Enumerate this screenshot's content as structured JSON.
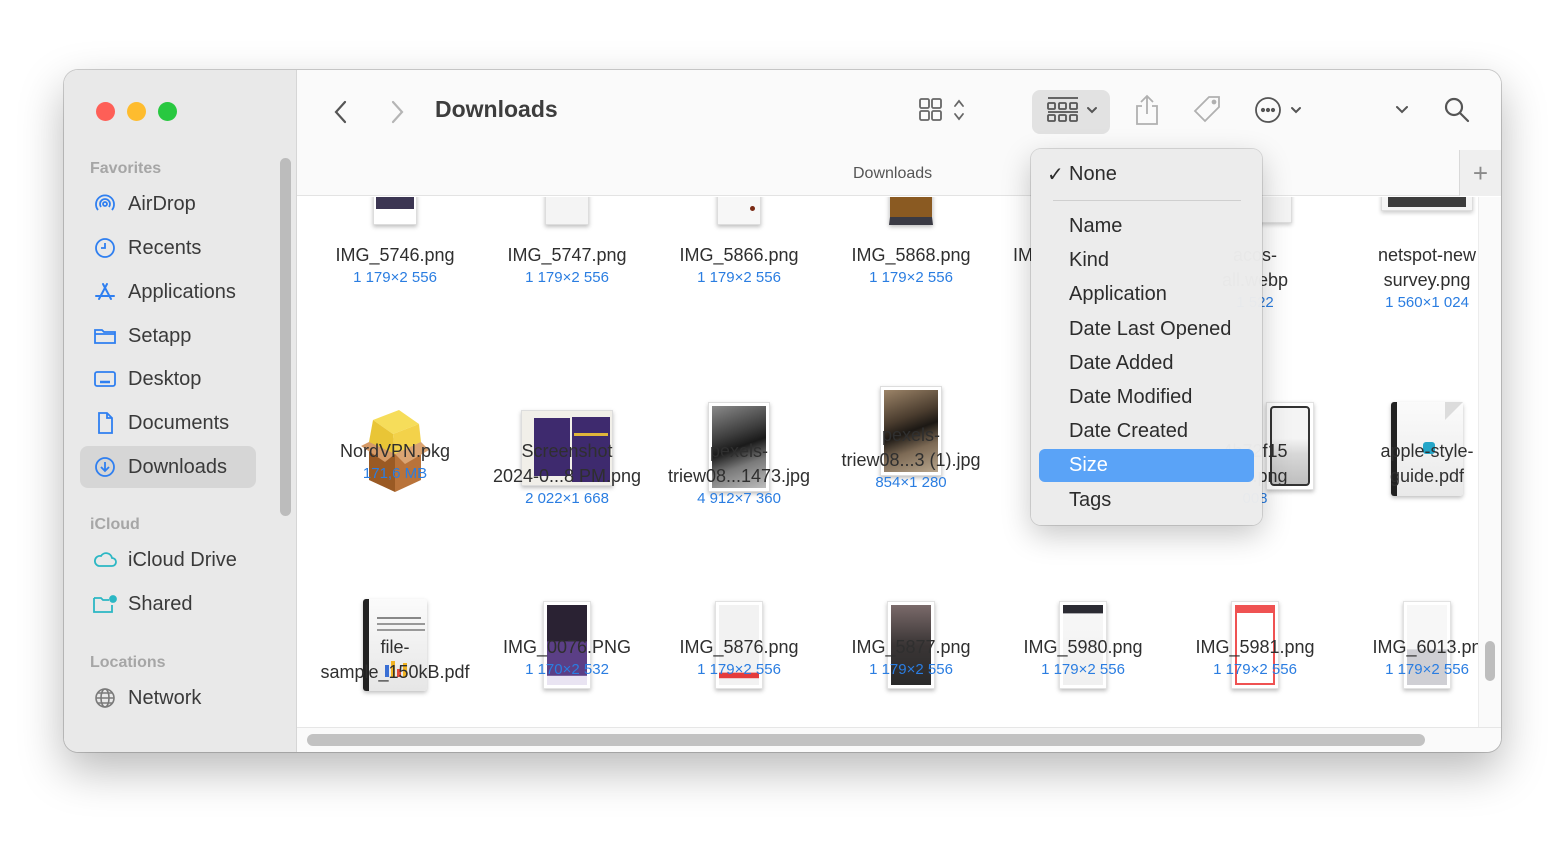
{
  "window": {
    "title": "Downloads",
    "path_label": "Downloads"
  },
  "sidebar": {
    "sections": [
      {
        "label": "Favorites",
        "items": [
          {
            "label": "AirDrop",
            "icon": "airdrop-icon"
          },
          {
            "label": "Recents",
            "icon": "clock-icon"
          },
          {
            "label": "Applications",
            "icon": "applications-icon"
          },
          {
            "label": "Setapp",
            "icon": "folder-icon"
          },
          {
            "label": "Desktop",
            "icon": "desktop-icon"
          },
          {
            "label": "Documents",
            "icon": "document-icon"
          },
          {
            "label": "Downloads",
            "icon": "download-icon",
            "active": true
          }
        ]
      },
      {
        "label": "iCloud",
        "items": [
          {
            "label": "iCloud Drive",
            "icon": "cloud-icon"
          },
          {
            "label": "Shared",
            "icon": "shared-folder-icon"
          }
        ]
      },
      {
        "label": "Locations",
        "items": [
          {
            "label": "Network",
            "icon": "globe-icon"
          }
        ]
      }
    ]
  },
  "toolbar": {
    "back": "‹",
    "forward": "›",
    "view_icon": "icon-view-grid",
    "group_icon": "group-by-icon",
    "share_icon": "share-icon",
    "tag_icon": "tag-icon",
    "more_icon": "more-actions-icon",
    "search_icon": "search-icon",
    "add_tab": "+"
  },
  "group_menu": {
    "checked": "None",
    "items": [
      "None",
      "Name",
      "Kind",
      "Application",
      "Date Last Opened",
      "Date Added",
      "Date Modified",
      "Date Created",
      "Size",
      "Tags"
    ],
    "highlighted": "Size"
  },
  "files": {
    "row1": [
      {
        "name": "IMG_5746.png",
        "meta": "1 179×2 556"
      },
      {
        "name": "IMG_5747.png",
        "meta": "1 179×2 556"
      },
      {
        "name": "IMG_5866.png",
        "meta": "1 179×2 556"
      },
      {
        "name": "IMG_5868.png",
        "meta": "1 179×2 556"
      },
      {
        "name": "IM",
        "meta": ""
      },
      {
        "name_l1": "acos-",
        "name_l2": "all.webp",
        "meta": "1 522"
      },
      {
        "name_l1": "netspot-new",
        "name_l2": "survey.png",
        "meta": "1 560×1 024"
      }
    ],
    "row2": [
      {
        "name": "NordVPN.pkg",
        "meta": "171,6 MB"
      },
      {
        "name_l1": "Screenshot",
        "name_l2": "2024-0...8 PM.png",
        "meta": "2 022×1 668"
      },
      {
        "name_l1": "pexels-",
        "name_l2": "triew08...1473.jpg",
        "meta": "4 912×7 360"
      },
      {
        "name_l1": "pexels-",
        "name_l2": "triew08...3 (1).jpg",
        "meta": "854×1 280"
      },
      {
        "name_l1": "4b72f15",
        "name_l2": "100.png",
        "meta": "008"
      },
      {
        "name_l1": "apple-style-",
        "name_l2": "guide.pdf",
        "meta": ""
      }
    ],
    "row3": [
      {
        "name_l1": "file-",
        "name_l2": "sample_150kB.pdf",
        "meta": ""
      },
      {
        "name": "IMG_0076.PNG",
        "meta": "1 170×2 532"
      },
      {
        "name": "IMG_5876.png",
        "meta": "1 179×2 556"
      },
      {
        "name": "IMG_5877.png",
        "meta": "1 179×2 556"
      },
      {
        "name": "IMG_5980.png",
        "meta": "1 179×2 556"
      },
      {
        "name": "IMG_5981.png",
        "meta": "1 179×2 556"
      },
      {
        "name": "IMG_6013.pn",
        "meta": "1 179×2 556"
      }
    ]
  }
}
